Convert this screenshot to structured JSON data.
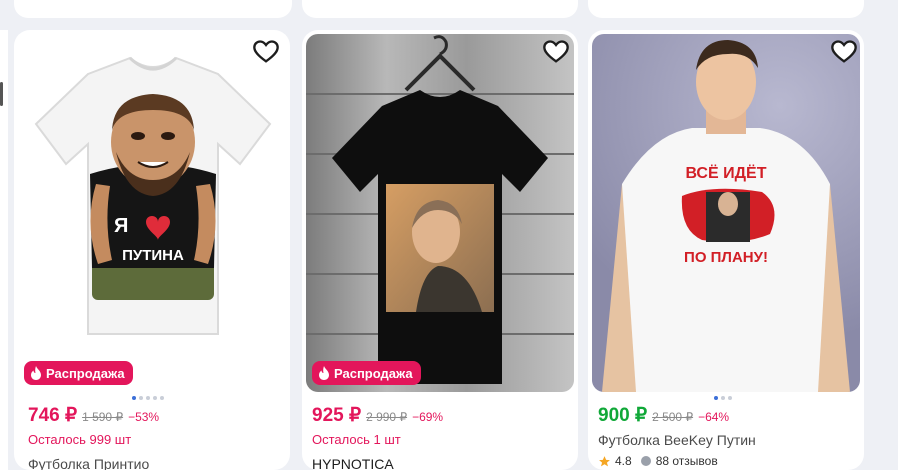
{
  "colors": {
    "sale_badge": "#e3165b",
    "sale_price": "#e3165b",
    "regular_price": "#10a838",
    "stock_text": "#e3165b",
    "star": "#f5a623"
  },
  "products": [
    {
      "image_text": [
        "Я",
        "ПУТИНА"
      ],
      "badge": "Распродажа",
      "price": "746 ₽",
      "old_price": "1 590 ₽",
      "discount": "−53%",
      "stock": "Осталось 999 шт",
      "title": "Футболка Принтио"
    },
    {
      "badge": "Распродажа",
      "price": "925 ₽",
      "old_price": "2 990 ₽",
      "discount": "−69%",
      "stock": "Осталось 1 шт",
      "title": "HYPNOTICA"
    },
    {
      "image_text": [
        "ВСЁ ИДЁТ",
        "ПО ПЛАНУ!"
      ],
      "price": "900 ₽",
      "old_price": "2 500 ₽",
      "discount": "−64%",
      "title": "Футболка BeeKey Путин",
      "rating": "4.8",
      "reviews": "88 отзывов"
    }
  ],
  "icons": [
    "heart-icon",
    "fire-icon",
    "star-icon",
    "comment-icon"
  ]
}
